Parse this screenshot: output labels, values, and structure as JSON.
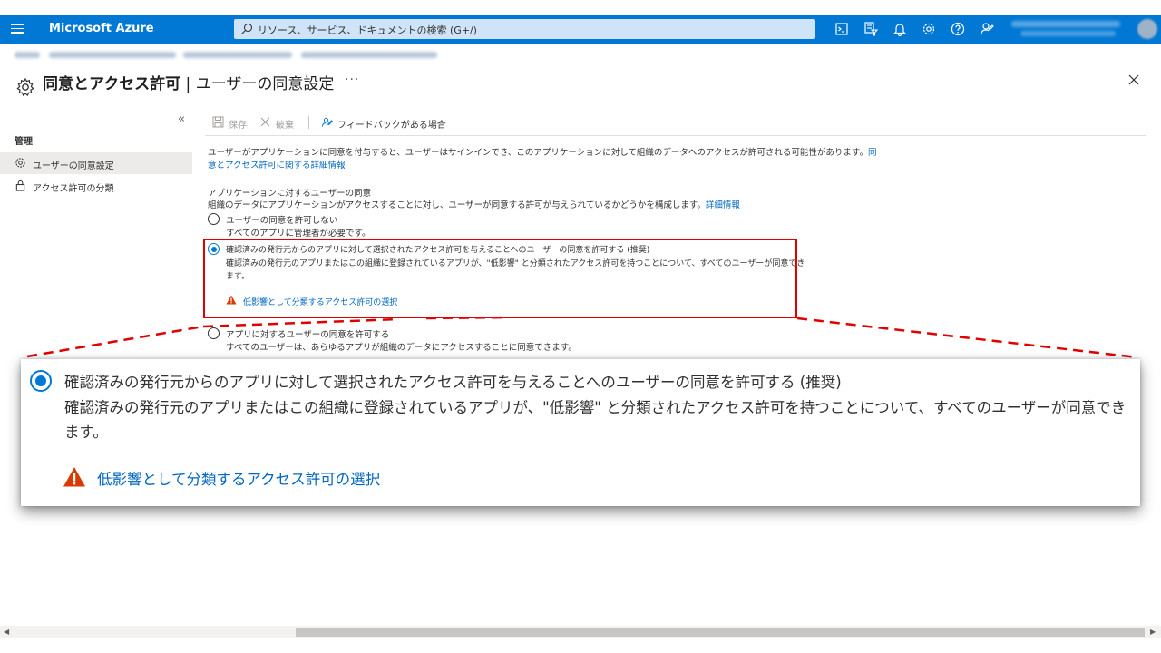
{
  "topbar": {
    "brand": "Microsoft Azure",
    "search_placeholder": "リソース、サービス、ドキュメントの検索 (G+/)",
    "icons": [
      "cloud-shell-icon",
      "directory-filter-icon",
      "notifications-icon",
      "settings-icon",
      "help-icon",
      "feedback-icon"
    ],
    "accent_color": "#0078d4"
  },
  "header": {
    "title": "同意とアクセス許可",
    "separator": " | ",
    "subtitle": "ユーザーの同意設定",
    "more": "···",
    "close": "×"
  },
  "sidebar": {
    "collapse": "«",
    "section": "管理",
    "items": [
      {
        "label": "ユーザーの同意設定",
        "icon": "gear-icon",
        "active": true
      },
      {
        "label": "アクセス許可の分類",
        "icon": "lock-icon",
        "active": false
      }
    ]
  },
  "toolbar": {
    "save_label": "保存",
    "discard_label": "破棄",
    "feedback_label": "フィードバックがある場合"
  },
  "content": {
    "intro_line1": "ユーザーがアプリケーションに同意を付与すると、ユーザーはサインインでき、このアプリケーションに対して組織のデータへのアクセスが許可される可能性があります。",
    "intro_link_part1": "同",
    "intro_link_part2": "意とアクセス許可に関する詳細情報",
    "section_title": "アプリケーションに対するユーザーの同意",
    "section_desc": "組織のデータにアプリケーションがアクセスすることに対し、ユーザーが同意する許可が与えられているかどうかを構成します。",
    "section_link": "詳細情報",
    "options": [
      {
        "title": "ユーザーの同意を許可しない",
        "desc": "すべてのアプリに管理者が必要です。",
        "selected": false
      },
      {
        "title": "確認済みの発行元からのアプリに対して選択されたアクセス許可を与えることへのユーザーの同意を許可する (推奨)",
        "desc_line1": "確認済みの発行元のアプリまたはこの組織に登録されているアプリが、\"低影響\" と分類されたアクセス許可を持つことについて、すべてのユーザーが同意でき",
        "desc_line2": "ます。",
        "link": "低影響として分類するアクセス許可の選択",
        "selected": true
      },
      {
        "title": "アプリに対するユーザーの同意を許可する",
        "desc": "すべてのユーザーは、あらゆるアプリが組織のデータにアクセスすることに同意できます。",
        "selected": false
      }
    ],
    "warning_color": "#d83b01",
    "highlight_color": "#e00000"
  },
  "callout": {
    "title": "確認済みの発行元からのアプリに対して選択されたアクセス許可を与えることへのユーザーの同意を許可する (推奨)",
    "desc_line1": "確認済みの発行元のアプリまたはこの組織に登録されているアプリが、\"低影響\" と分類されたアクセス許可を持つことについて、すべてのユーザーが同意でき",
    "desc_line2": "ます。",
    "link": "低影響として分類するアクセス許可の選択"
  },
  "scrollbar": {
    "left_arrow": "◀",
    "right_arrow": "▶"
  }
}
